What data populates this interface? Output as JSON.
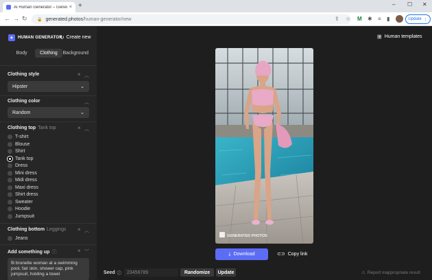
{
  "browser": {
    "tab_title": "AI Human Generator – Generate",
    "tab_close": "×",
    "new_tab": "+",
    "url_domain": "generated.photos",
    "url_path": "/human-generator/new",
    "update_label": "Update"
  },
  "sidebar": {
    "brand": "HUMAN GENERATOR",
    "create_new": "Create new",
    "tabs": [
      "Body",
      "Clothing",
      "Background"
    ],
    "active_tab": "Clothing",
    "clothing_style": {
      "title": "Clothing style",
      "value": "Hipster"
    },
    "clothing_color": {
      "title": "Clothing color",
      "value": "Random"
    },
    "clothing_top": {
      "title": "Clothing top",
      "selected_label": "Tank top",
      "options": [
        "T-shirt",
        "Blouse",
        "Shirt",
        "Tank top",
        "Dress",
        "Mini dress",
        "Midi dress",
        "Maxi dress",
        "Shirt dress",
        "Sweater",
        "Hoodie",
        "Jumpsuit"
      ],
      "selected": "Tank top"
    },
    "clothing_bottom": {
      "title": "Clothing bottom",
      "selected_label": "Leggings",
      "options": [
        "Jeans"
      ]
    },
    "add_something": {
      "title": "Add something up",
      "text": "fit brunette woman at a swimming pool, fair skin, shower cap, pink jumpsuit, holding a towel"
    }
  },
  "main": {
    "human_templates": "Human templates",
    "watermark": "GENERATED PHOTOS",
    "download": "Download",
    "copy_link": "Copy link",
    "seed_label": "Seed",
    "seed_placeholder": "23456789",
    "randomize": "Randomize",
    "update": "Update",
    "report": "Report inappropriate result"
  }
}
